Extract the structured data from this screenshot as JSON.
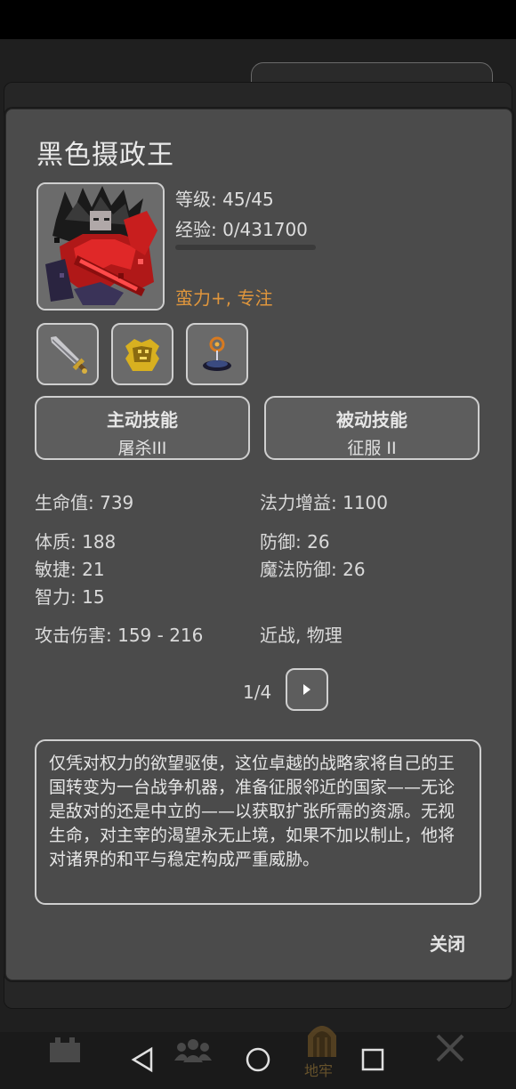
{
  "hero": {
    "name": "黑色摄政王",
    "level": "等级: 45/45",
    "exp": "经验: 0/431700",
    "exp_progress": 0,
    "traits": "蛮力+, 专注"
  },
  "equipment": [
    {
      "name": "sword-icon"
    },
    {
      "name": "golden-armor-icon"
    },
    {
      "name": "amulet-icon"
    }
  ],
  "skills": {
    "active": {
      "header": "主动技能",
      "name": "屠杀III"
    },
    "passive": {
      "header": "被动技能",
      "name": "征服 II"
    }
  },
  "stats": {
    "hp": "生命值: 739",
    "mana_gain": "法力增益: 1100",
    "constitution": "体质: 188",
    "defense": "防御: 26",
    "agility": "敏捷: 21",
    "magic_defense": "魔法防御: 26",
    "intellect": "智力: 15",
    "attack": "攻击伤害: 159 - 216",
    "attack_type": "近战, 物理"
  },
  "pager": {
    "label": "1/4"
  },
  "description": "仅凭对权力的欲望驱使，这位卓越的战略家将自己的王国转变为一台战争机器，准备征服邻近的国家——无论是敌对的还是中立的——以获取扩张所需的资源。无视生命，对主宰的渴望永无止境，如果不加以制止，他将对诸界的和平与稳定构成严重威胁。",
  "close_label": "关闭",
  "bottom_tabs": [
    {
      "icon": "castle-icon"
    },
    {
      "icon": "heroes-icon"
    },
    {
      "icon": "dungeon-door-icon",
      "label": "地牢"
    },
    {
      "icon": "crossed-swords-icon"
    }
  ],
  "colors": {
    "trait_accent": "#e0963c",
    "panel": "#4b4b4b"
  }
}
